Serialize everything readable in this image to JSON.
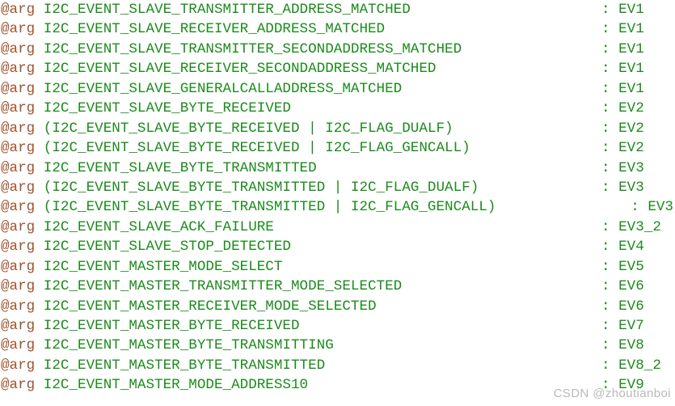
{
  "document": {
    "kind": "source-code-doc-comment",
    "background_color": "#ffffff",
    "token_colors": {
      "tag": "#a0522d",
      "expression": "#1d8b1d",
      "separator": "#1d8b1d",
      "value": "#1d8b1d",
      "watermark": "#b9b9b9"
    },
    "separator": ":",
    "lines": [
      {
        "tag": "@arg",
        "expression": "I2C_EVENT_SLAVE_TRANSMITTER_ADDRESS_MATCHED",
        "value": "EV1"
      },
      {
        "tag": "@arg",
        "expression": "I2C_EVENT_SLAVE_RECEIVER_ADDRESS_MATCHED",
        "value": "EV1"
      },
      {
        "tag": "@arg",
        "expression": "I2C_EVENT_SLAVE_TRANSMITTER_SECONDADDRESS_MATCHED",
        "value": "EV1"
      },
      {
        "tag": "@arg",
        "expression": "I2C_EVENT_SLAVE_RECEIVER_SECONDADDRESS_MATCHED",
        "value": "EV1"
      },
      {
        "tag": "@arg",
        "expression": "I2C_EVENT_SLAVE_GENERALCALLADDRESS_MATCHED",
        "value": "EV1"
      },
      {
        "tag": "@arg",
        "expression": "I2C_EVENT_SLAVE_BYTE_RECEIVED",
        "value": "EV2"
      },
      {
        "tag": "@arg",
        "expression": "(I2C_EVENT_SLAVE_BYTE_RECEIVED | I2C_FLAG_DUALF)",
        "value": "EV2"
      },
      {
        "tag": "@arg",
        "expression": "(I2C_EVENT_SLAVE_BYTE_RECEIVED | I2C_FLAG_GENCALL)",
        "value": "EV2"
      },
      {
        "tag": "@arg",
        "expression": "I2C_EVENT_SLAVE_BYTE_TRANSMITTED",
        "value": "EV3"
      },
      {
        "tag": "@arg",
        "expression": "(I2C_EVENT_SLAVE_BYTE_TRANSMITTED | I2C_FLAG_DUALF)",
        "value": "EV3"
      },
      {
        "tag": "@arg",
        "expression": "(I2C_EVENT_SLAVE_BYTE_TRANSMITTED | I2C_FLAG_GENCALL)",
        "value": "EV3",
        "flush": true
      },
      {
        "tag": "@arg",
        "expression": "I2C_EVENT_SLAVE_ACK_FAILURE",
        "value": "EV3_2"
      },
      {
        "tag": "@arg",
        "expression": "I2C_EVENT_SLAVE_STOP_DETECTED",
        "value": "EV4"
      },
      {
        "tag": "@arg",
        "expression": "I2C_EVENT_MASTER_MODE_SELECT",
        "value": "EV5"
      },
      {
        "tag": "@arg",
        "expression": "I2C_EVENT_MASTER_TRANSMITTER_MODE_SELECTED",
        "value": "EV6"
      },
      {
        "tag": "@arg",
        "expression": "I2C_EVENT_MASTER_RECEIVER_MODE_SELECTED",
        "value": "EV6"
      },
      {
        "tag": "@arg",
        "expression": "I2C_EVENT_MASTER_BYTE_RECEIVED",
        "value": "EV7"
      },
      {
        "tag": "@arg",
        "expression": "I2C_EVENT_MASTER_BYTE_TRANSMITTING",
        "value": "EV8"
      },
      {
        "tag": "@arg",
        "expression": "I2C_EVENT_MASTER_BYTE_TRANSMITTED",
        "value": "EV8_2"
      },
      {
        "tag": "@arg",
        "expression": "I2C_EVENT_MASTER_MODE_ADDRESS10",
        "value": "EV9"
      }
    ]
  },
  "watermark": {
    "text": "CSDN @zhoutianboi"
  }
}
